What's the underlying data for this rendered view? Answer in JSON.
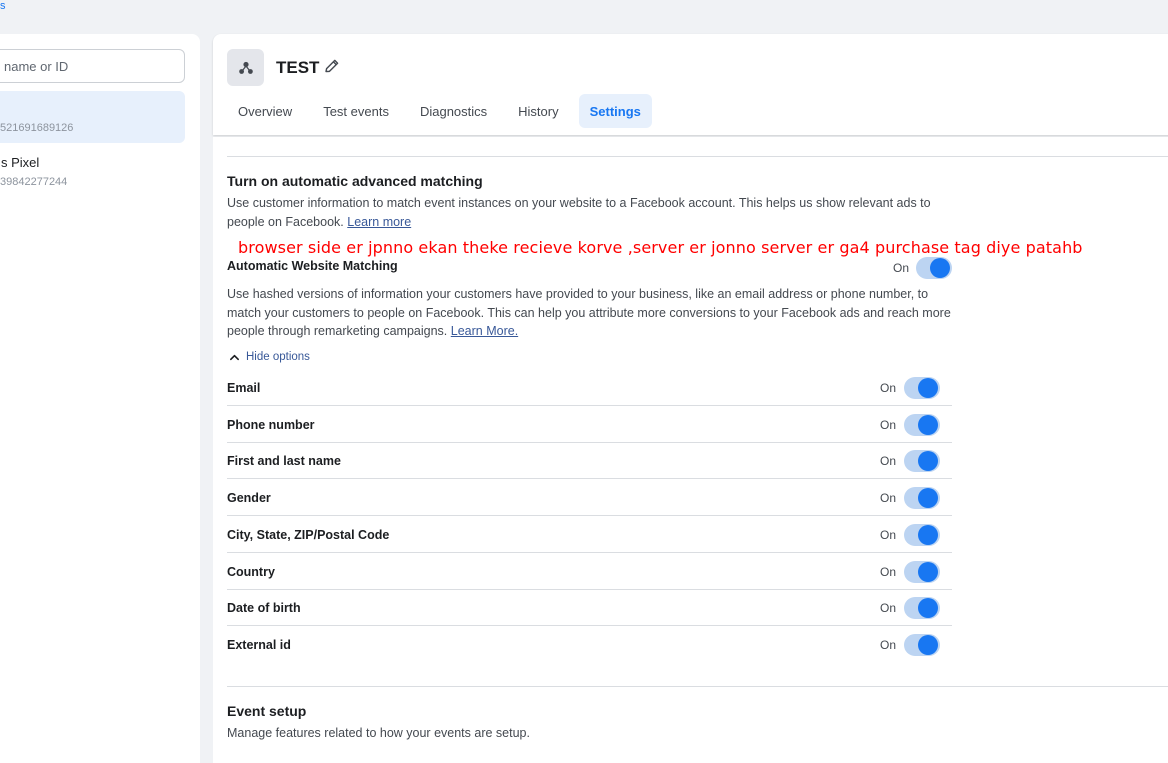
{
  "topbar": {
    "fragment": "s"
  },
  "sidebar": {
    "search": {
      "placeholder": "name or ID"
    },
    "pixels": [
      {
        "name": "",
        "id": "521691689126"
      },
      {
        "name": "s Pixel",
        "id": "39842277244"
      }
    ]
  },
  "header": {
    "title": "TEST",
    "tabs": [
      {
        "label": "Overview"
      },
      {
        "label": "Test events"
      },
      {
        "label": "Diagnostics"
      },
      {
        "label": "History"
      },
      {
        "label": "Settings"
      }
    ],
    "active_tab": "Settings"
  },
  "matching": {
    "title": "Turn on automatic advanced matching",
    "description": "Use customer information to match event instances on your website to a Facebook account. This helps us show relevant ads to people on Facebook.",
    "learn_more": "Learn more",
    "annotation": "browser side er jpnno ekan theke recieve korve ,server er jonno server er ga4 purchase tag diye patahb",
    "auto_label": "Automatic Website Matching",
    "auto_state": "On",
    "auto_description": "Use hashed versions of information your customers have provided to your business, like an email address or phone number, to match your customers to people on Facebook. This can help you attribute more conversions to your Facebook ads and reach more people through remarketing campaigns.",
    "auto_learn_more": "Learn More.",
    "hide_options": "Hide options",
    "options": [
      {
        "label": "Email",
        "state": "On"
      },
      {
        "label": "Phone number",
        "state": "On"
      },
      {
        "label": "First and last name",
        "state": "On"
      },
      {
        "label": "Gender",
        "state": "On"
      },
      {
        "label": "City, State, ZIP/Postal Code",
        "state": "On"
      },
      {
        "label": "Country",
        "state": "On"
      },
      {
        "label": "Date of birth",
        "state": "On"
      },
      {
        "label": "External id",
        "state": "On"
      }
    ]
  },
  "event_setup": {
    "title": "Event setup",
    "description": "Manage features related to how your events are setup."
  },
  "colors": {
    "accent": "#1877f2",
    "toggle_track": "#bcd4f2",
    "annotation": "#ff0000",
    "link": "#385898"
  }
}
